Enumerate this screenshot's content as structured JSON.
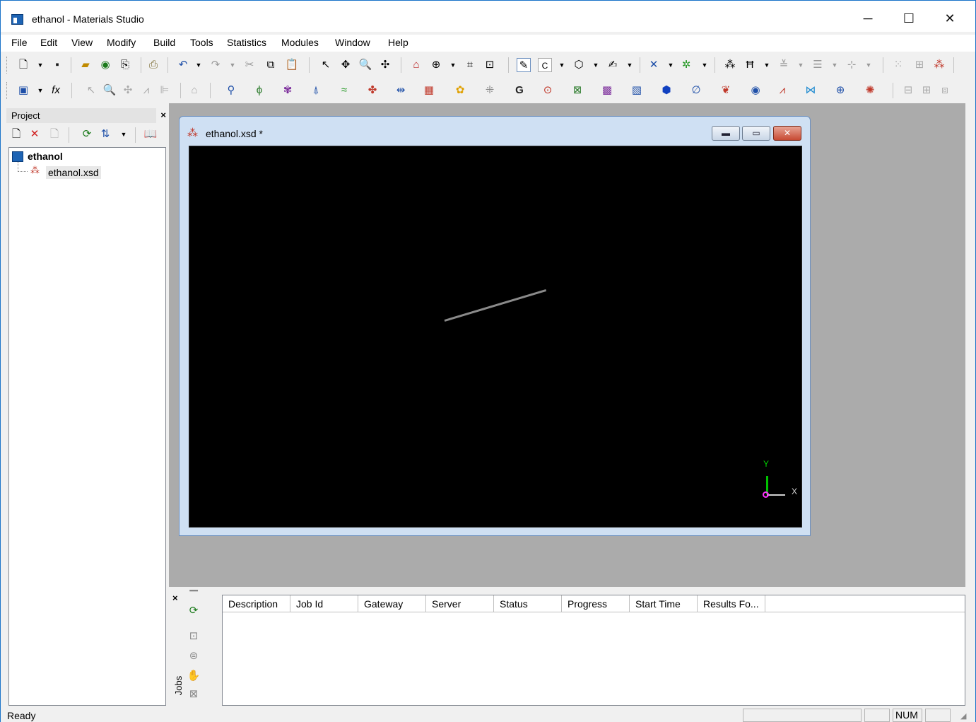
{
  "window": {
    "title": "ethanol - Materials Studio",
    "controls": {
      "minimize": "─",
      "maximize": "☐",
      "close": "✕"
    }
  },
  "menu": {
    "items": [
      "File",
      "Edit",
      "View",
      "Modify",
      "Build",
      "Tools",
      "Statistics",
      "Modules",
      "Window",
      "Help"
    ]
  },
  "project_panel": {
    "title": "Project",
    "close": "×",
    "tree": {
      "root": "ethanol",
      "children": [
        "ethanol.xsd"
      ]
    }
  },
  "document_window": {
    "title": "ethanol.xsd *",
    "axes": {
      "y_label": "Y",
      "x_label": "X"
    },
    "colors": {
      "background": "#000000",
      "bond": "#8a8a8a",
      "y_axis": "#00c000",
      "x_axis": "#d0d0d0",
      "origin": "#ff30ff"
    }
  },
  "jobs_panel": {
    "label": "Jobs",
    "close": "×",
    "columns": [
      "Description",
      "Job Id",
      "Gateway",
      "Server",
      "Status",
      "Progress",
      "Start Time",
      "Results Fo..."
    ]
  },
  "status_bar": {
    "text": "Ready",
    "num_indicator": "NUM"
  }
}
